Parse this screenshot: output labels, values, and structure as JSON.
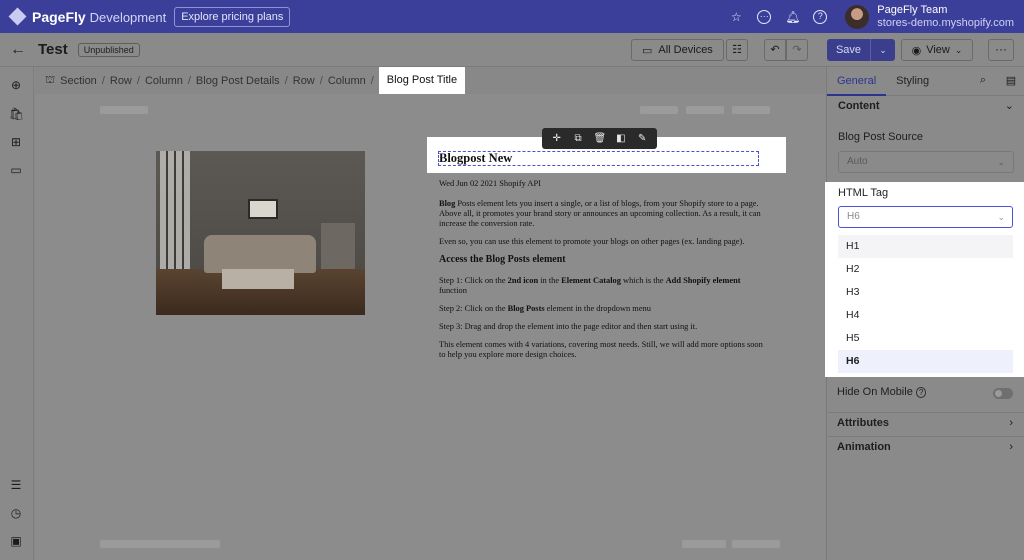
{
  "topbar": {
    "brand": "PageFly",
    "env": "Development",
    "pricing_button": "Explore pricing plans",
    "user_name": "PageFly Team",
    "user_store": "stores-demo.myshopify.com"
  },
  "subbar": {
    "title": "Test",
    "status_badge": "Unpublished",
    "devices_label": "All Devices",
    "save_label": "Save",
    "view_label": "View",
    "more_label": "···"
  },
  "breadcrumb": {
    "items": [
      "Section",
      "Row",
      "Column",
      "Blog Post Details",
      "Row",
      "Column"
    ],
    "current": "Blog Post Title"
  },
  "canvas": {
    "blog_title": "Blogpost New",
    "meta": "Wed Jun 02 2021 Shopify API",
    "p1_bold": "Blog",
    "p1_rest": " Posts element lets you insert a single, or a list of blogs, from your Shopify store to a page. Above all, it promotes your brand story or announces an upcoming collection. As a result, it can increase the conversion rate.",
    "p2": "Even so, you can use this element to promote your blogs on other pages (ex. landing page).",
    "heading": "Access the Blog Posts element",
    "step1_a": "Step 1: Click on the ",
    "step1_b": "2nd icon",
    "step1_c": " in the ",
    "step1_d": "Element Catalog",
    "step1_e": " which is the ",
    "step1_f": "Add Shopify element",
    "step1_g": " function",
    "step2_a": "Step 2: Click on the ",
    "step2_b": "Blog Posts",
    "step2_c": " element in the dropdown menu",
    "step3": "Step 3: Drag and drop the element into the page editor and then start using it.",
    "p_last": "This element comes with 4 variations, covering most needs. Still, we will add more options soon to help you explore more design choices."
  },
  "panel": {
    "tab_general": "General",
    "tab_styling": "Styling",
    "content_header": "Content",
    "source_label": "Blog Post Source",
    "source_value": "Auto",
    "html_tag_label": "HTML Tag",
    "html_tag_value": "H6",
    "html_tag_options": [
      "H1",
      "H2",
      "H3",
      "H4",
      "H5",
      "H6"
    ],
    "hide_on_mobile": "Hide On Mobile",
    "attributes": "Attributes",
    "animation": "Animation"
  },
  "colors": {
    "brand_bar": "#3b3f9a",
    "accent": "#4b52d6",
    "overlay": "#8a8a8a"
  },
  "icons": [
    "star-icon",
    "chat-icon",
    "bell-icon",
    "help-icon",
    "back-arrow-icon",
    "monitor-icon",
    "sliders-icon",
    "undo-icon",
    "redo-icon",
    "eye-icon",
    "search-icon",
    "file-icon",
    "plus-circle-icon",
    "shopify-bag-icon",
    "grid-icon",
    "folder-icon",
    "list-icon",
    "clock-icon",
    "terminal-icon"
  ]
}
